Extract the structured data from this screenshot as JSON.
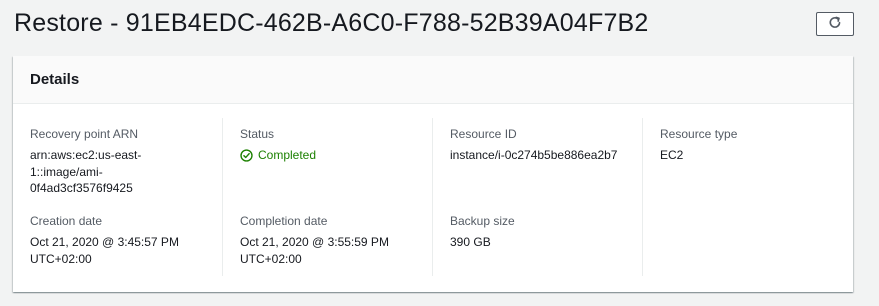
{
  "header": {
    "title": "Restore - 91EB4EDC-462B-A6C0-F788-52B39A04F7B2",
    "refresh_icon": "refresh-icon"
  },
  "details": {
    "title": "Details",
    "recovery_point_arn": {
      "label": "Recovery point ARN",
      "line1": "arn:aws:ec2:us-east-",
      "line2": "1::image/ami-",
      "line3": "0f4ad3cf3576f9425"
    },
    "status": {
      "label": "Status",
      "value": "Completed",
      "icon": "check-circle-icon",
      "color": "#1d8102"
    },
    "resource_id": {
      "label": "Resource ID",
      "value": "instance/i-0c274b5be886ea2b7"
    },
    "resource_type": {
      "label": "Resource type",
      "value": "EC2"
    },
    "creation_date": {
      "label": "Creation date",
      "line1": "Oct 21, 2020 @ 3:45:57 PM",
      "line2": "UTC+02:00"
    },
    "completion_date": {
      "label": "Completion date",
      "line1": "Oct 21, 2020 @ 3:55:59 PM",
      "line2": "UTC+02:00"
    },
    "backup_size": {
      "label": "Backup size",
      "value": "390 GB"
    }
  }
}
